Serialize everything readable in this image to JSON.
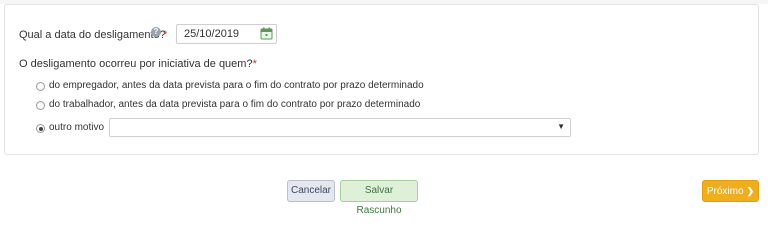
{
  "question1": {
    "label": "Qual a data do desligamento?",
    "help_icon": "?",
    "required_mark": "*",
    "date_value": "25/10/2019"
  },
  "question2": {
    "label": "O desligamento ocorreu por iniciativa de quem?",
    "required_mark": "*",
    "options": [
      {
        "label": "do empregador, antes da data prevista para o fim do contrato por prazo determinado",
        "selected": false
      },
      {
        "label": "do trabalhador, antes da data prevista para o fim do contrato por prazo determinado",
        "selected": false
      },
      {
        "label": "outro motivo",
        "selected": true
      }
    ],
    "other_select_value": ""
  },
  "buttons": {
    "cancel": "Cancelar",
    "save_draft": "Salvar Rascunho",
    "next": "Próximo"
  },
  "colors": {
    "next_button": "#f0ad1e",
    "draft_button": "#dff0d8",
    "cancel_button": "#e4e7ee",
    "required": "#c0392b"
  },
  "icons": {
    "help": "question-circle-icon",
    "date": "calendar-icon",
    "select": "caret-down-icon",
    "next": "chevron-right-icon"
  }
}
